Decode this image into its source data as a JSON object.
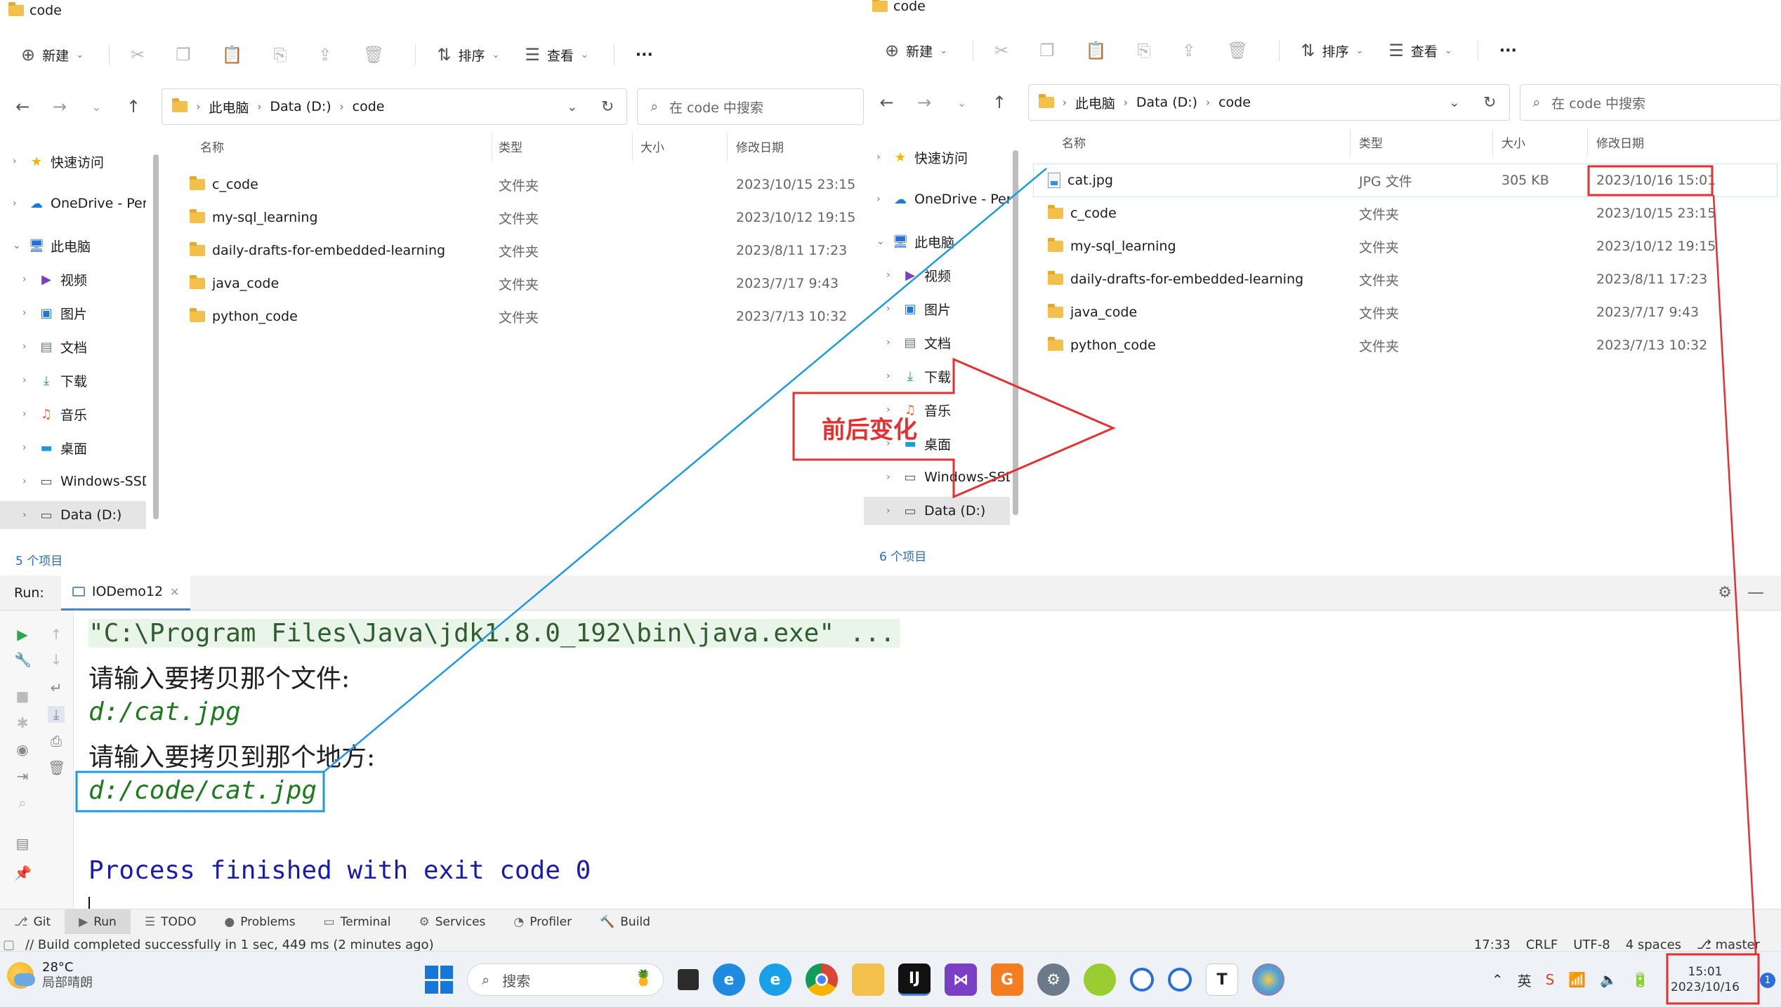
{
  "explorer_left": {
    "title": "code",
    "toolbar": {
      "new": "新建",
      "sort": "排序",
      "view": "查看",
      "more": "···"
    },
    "breadcrumb": [
      "此电脑",
      "Data (D:)",
      "code"
    ],
    "search_placeholder": "在 code 中搜索",
    "columns": {
      "name": "名称",
      "type": "类型",
      "size": "大小",
      "date": "修改日期"
    },
    "sidebar": [
      {
        "label": "快速访问",
        "icon": "star-icon"
      },
      {
        "label": "OneDrive - Pers",
        "icon": "cloud-icon"
      },
      {
        "label": "此电脑",
        "icon": "pc-icon"
      },
      {
        "label": "视频",
        "icon": "video-icon"
      },
      {
        "label": "图片",
        "icon": "picture-icon"
      },
      {
        "label": "文档",
        "icon": "document-icon"
      },
      {
        "label": "下载",
        "icon": "download-icon"
      },
      {
        "label": "音乐",
        "icon": "music-icon"
      },
      {
        "label": "桌面",
        "icon": "desktop-icon"
      },
      {
        "label": "Windows-SSD",
        "icon": "drive-icon"
      },
      {
        "label": "Data (D:)",
        "icon": "drive-icon"
      }
    ],
    "files": [
      {
        "name": "c_code",
        "type": "文件夹",
        "size": "",
        "date": "2023/10/15 23:15"
      },
      {
        "name": "my-sql_learning",
        "type": "文件夹",
        "size": "",
        "date": "2023/10/12 19:15"
      },
      {
        "name": "daily-drafts-for-embedded-learning",
        "type": "文件夹",
        "size": "",
        "date": "2023/8/11 17:23"
      },
      {
        "name": "java_code",
        "type": "文件夹",
        "size": "",
        "date": "2023/7/17 9:43"
      },
      {
        "name": "python_code",
        "type": "文件夹",
        "size": "",
        "date": "2023/7/13 10:32"
      }
    ],
    "status": "5 个项目"
  },
  "explorer_right": {
    "title": "code",
    "toolbar": {
      "new": "新建",
      "sort": "排序",
      "view": "查看",
      "more": "···"
    },
    "breadcrumb": [
      "此电脑",
      "Data (D:)",
      "code"
    ],
    "search_placeholder": "在 code 中搜索",
    "columns": {
      "name": "名称",
      "type": "类型",
      "size": "大小",
      "date": "修改日期"
    },
    "sidebar": [
      {
        "label": "快速访问",
        "icon": "star-icon"
      },
      {
        "label": "OneDrive - Pers",
        "icon": "cloud-icon"
      },
      {
        "label": "此电脑",
        "icon": "pc-icon"
      },
      {
        "label": "视频",
        "icon": "video-icon"
      },
      {
        "label": "图片",
        "icon": "picture-icon"
      },
      {
        "label": "文档",
        "icon": "document-icon"
      },
      {
        "label": "下载",
        "icon": "download-icon"
      },
      {
        "label": "音乐",
        "icon": "music-icon"
      },
      {
        "label": "桌面",
        "icon": "desktop-icon"
      },
      {
        "label": "Windows-SSD",
        "icon": "drive-icon"
      },
      {
        "label": "Data (D:)",
        "icon": "drive-icon"
      }
    ],
    "files": [
      {
        "name": "cat.jpg",
        "type": "JPG 文件",
        "size": "305 KB",
        "date": "2023/10/16 15:01"
      },
      {
        "name": "c_code",
        "type": "文件夹",
        "size": "",
        "date": "2023/10/15 23:15"
      },
      {
        "name": "my-sql_learning",
        "type": "文件夹",
        "size": "",
        "date": "2023/10/12 19:15"
      },
      {
        "name": "daily-drafts-for-embedded-learning",
        "type": "文件夹",
        "size": "",
        "date": "2023/8/11 17:23"
      },
      {
        "name": "java_code",
        "type": "文件夹",
        "size": "",
        "date": "2023/7/17 9:43"
      },
      {
        "name": "python_code",
        "type": "文件夹",
        "size": "",
        "date": "2023/7/13 10:32"
      }
    ],
    "status": "6 个项目"
  },
  "annotation": {
    "label": "前后变化",
    "color_red": "#e53030",
    "color_blue": "#1e9be0"
  },
  "ide": {
    "run_label": "Run:",
    "run_tab": "IODemo12",
    "console": {
      "cmd": "\"C:\\Program Files\\Java\\jdk1.8.0_192\\bin\\java.exe\" ...",
      "prompt1": "请输入要拷贝那个文件:",
      "input1": "d:/cat.jpg",
      "prompt2": "请输入要拷贝到那个地方:",
      "input2": "d:/code/cat.jpg",
      "done": "Process finished with exit code 0"
    },
    "bottom_tabs": [
      "Git",
      "Run",
      "TODO",
      "Problems",
      "Terminal",
      "Services",
      "Profiler",
      "Build"
    ],
    "status_msg": "// Build completed successfully in 1 sec, 449 ms (2 minutes ago)",
    "status_right": [
      "17:33",
      "CRLF",
      "UTF-8",
      "4 spaces",
      "master"
    ]
  },
  "taskbar": {
    "weather_temp": "28°C",
    "weather_desc": "局部晴朗",
    "search_label": "搜索",
    "time": "15:01",
    "date": "2023/10/16",
    "notif_count": "1"
  }
}
